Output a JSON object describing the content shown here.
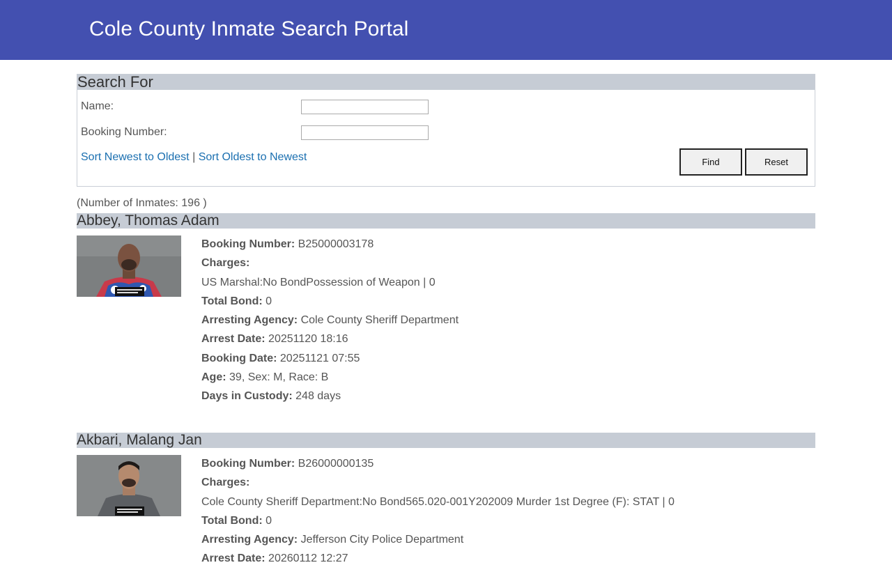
{
  "header": {
    "title": "Cole County Inmate Search Portal"
  },
  "search": {
    "heading": "Search For",
    "name_label": "Name:",
    "name_value": "",
    "booking_label": "Booking Number:",
    "booking_value": "",
    "sort_newest": "Sort Newest to Oldest",
    "separator": "|",
    "sort_oldest": "Sort Oldest to Newest",
    "find_label": "Find",
    "reset_label": "Reset"
  },
  "count_text": "(Number of Inmates: 196 )",
  "labels": {
    "booking_number": "Booking Number:",
    "charges": "Charges:",
    "total_bond": "Total Bond:",
    "arresting_agency": "Arresting Agency:",
    "arrest_date": "Arrest Date:",
    "booking_date": "Booking Date:",
    "age": "Age:",
    "days_in_custody": "Days in Custody:"
  },
  "inmates": [
    {
      "name": "Abbey, Thomas Adam",
      "booking_number": "B25000003178",
      "charges": "US Marshal:No BondPossession of Weapon | 0",
      "total_bond": "0",
      "arresting_agency": "Cole County Sheriff Department",
      "arrest_date": "20251120 18:16",
      "booking_date": "20251121 07:55",
      "age_sex_race": "39, Sex: M, Race: B",
      "days_in_custody": "248 days"
    },
    {
      "name": "Akbari, Malang Jan",
      "booking_number": "B26000000135",
      "charges": "Cole County Sheriff Department:No Bond565.020-001Y202009 Murder 1st Degree (F): STAT | 0",
      "total_bond": "0",
      "arresting_agency": "Jefferson City Police Department",
      "arrest_date": "20260112 12:27"
    }
  ]
}
